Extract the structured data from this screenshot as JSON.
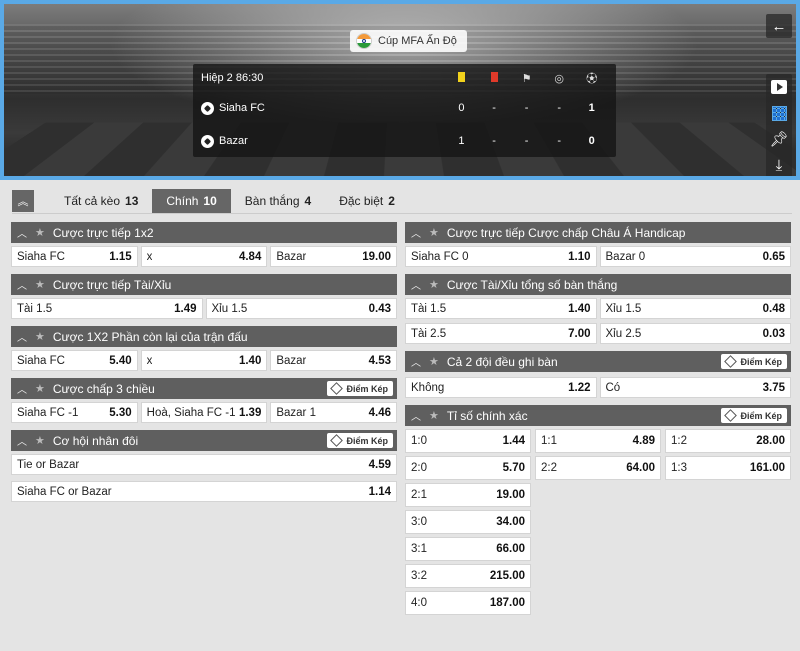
{
  "header": {
    "league": "Cúp MFA Ấn Độ",
    "period": "Hiệp 2 86:30",
    "teams": [
      {
        "name": "Siaha FC",
        "stats": [
          "0",
          "-",
          "-",
          "-",
          "1"
        ]
      },
      {
        "name": "Bazar",
        "stats": [
          "1",
          "-",
          "-",
          "-",
          "0"
        ]
      }
    ],
    "stat_icons": [
      "yellow-card",
      "red-card",
      "corner",
      "penalty",
      "goal"
    ]
  },
  "tabs": [
    {
      "label": "Tất cả kèo",
      "count": "13"
    },
    {
      "label": "Chính",
      "count": "10",
      "active": true
    },
    {
      "label": "Bàn thắng",
      "count": "4"
    },
    {
      "label": "Đặc biệt",
      "count": "2"
    }
  ],
  "badge_label": "Điểm Kép",
  "left": {
    "p1": {
      "title": "Cược trực tiếp 1x2",
      "odds": [
        [
          "Siaha FC",
          "1.15"
        ],
        [
          "x",
          "4.84"
        ],
        [
          "Bazar",
          "19.00"
        ]
      ]
    },
    "p2": {
      "title": "Cược trực tiếp Tài/Xỉu",
      "odds": [
        [
          "Tài 1.5",
          "1.49"
        ],
        [
          "Xỉu 1.5",
          "0.43"
        ]
      ]
    },
    "p3": {
      "title": "Cược 1X2 Phần còn lại của trận đấu",
      "odds": [
        [
          "Siaha FC",
          "5.40"
        ],
        [
          "x",
          "1.40"
        ],
        [
          "Bazar",
          "4.53"
        ]
      ]
    },
    "p4": {
      "title": "Cược chấp 3 chiều",
      "odds": [
        [
          "Siaha FC -1",
          "5.30"
        ],
        [
          "Hoà, Siaha FC -1",
          "1.39"
        ],
        [
          "Bazar 1",
          "4.46"
        ]
      ]
    },
    "p5": {
      "title": "Cơ hội nhân đôi",
      "odds": [
        [
          "Tie or Bazar",
          "4.59"
        ],
        [
          "Siaha FC or Bazar",
          "1.14"
        ]
      ]
    }
  },
  "right": {
    "p1": {
      "title": "Cược trực tiếp Cược chấp Châu Á Handicap",
      "odds": [
        [
          "Siaha FC 0",
          "1.10"
        ],
        [
          "Bazar 0",
          "0.65"
        ]
      ]
    },
    "p2": {
      "title": "Cược Tài/Xỉu tổng số bàn thắng",
      "odds": [
        [
          "Tài 1.5",
          "1.40"
        ],
        [
          "Xỉu 1.5",
          "0.48"
        ],
        [
          "Tài 2.5",
          "7.00"
        ],
        [
          "Xỉu 2.5",
          "0.03"
        ]
      ]
    },
    "p3": {
      "title": "Cả 2 đội đều ghi bàn",
      "odds": [
        [
          "Không",
          "1.22"
        ],
        [
          "Có",
          "3.75"
        ]
      ]
    },
    "p4": {
      "title": "Tỉ số chính xác",
      "odds": [
        [
          "1:0",
          "1.44"
        ],
        [
          "1:1",
          "4.89"
        ],
        [
          "1:2",
          "28.00"
        ],
        [
          "2:0",
          "5.70"
        ],
        [
          "2:2",
          "64.00"
        ],
        [
          "1:3",
          "161.00"
        ],
        [
          "2:1",
          "19.00"
        ],
        [
          "3:0",
          "34.00"
        ],
        [
          "3:1",
          "66.00"
        ],
        [
          "3:2",
          "215.00"
        ],
        [
          "4:0",
          "187.00"
        ]
      ]
    }
  }
}
